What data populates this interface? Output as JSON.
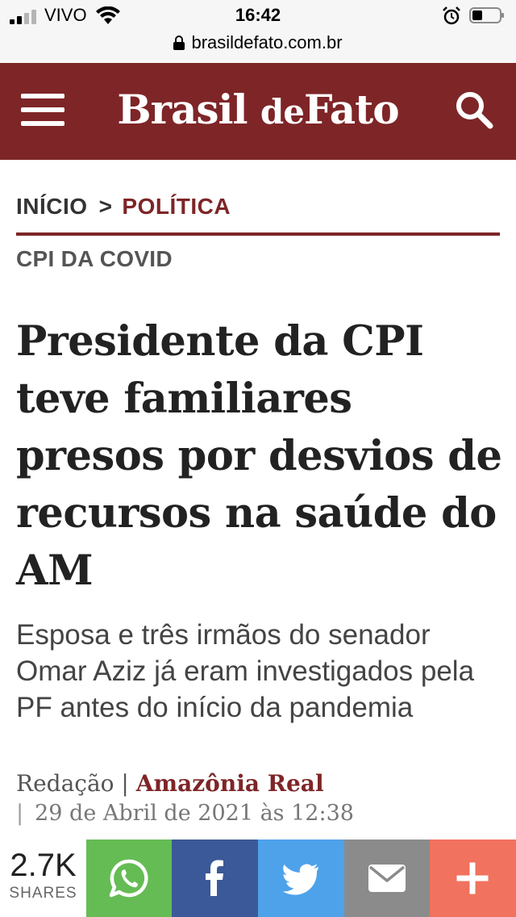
{
  "status_bar": {
    "carrier": "VIVO",
    "time": "16:42",
    "url": "brasildefato.com.br"
  },
  "header": {
    "logo_part1": "Brasil",
    "logo_part2": "de",
    "logo_part3": "Fato",
    "background_color": "#7e2527"
  },
  "breadcrumb": {
    "home": "INÍCIO",
    "separator": ">",
    "category": "POLÍTICA"
  },
  "article": {
    "tag": "CPI DA COVID",
    "headline": "Presidente da CPI teve familiares presos por desvios de recursos na saúde do AM",
    "subheadline": "Esposa e três irmãos do senador Omar Aziz já eram investigados pela PF antes do início da pandemia",
    "author": "Redação",
    "byline_separator": "|",
    "source": "Amazônia Real",
    "date_separator": "|",
    "date": "29 de Abril de 2021 às 12:38"
  },
  "share_bar": {
    "count": "2.7K",
    "count_label": "SHARES",
    "buttons": [
      "whatsapp-icon",
      "facebook-icon",
      "twitter-icon",
      "email-icon",
      "plus-icon"
    ],
    "colors": {
      "whatsapp": "#65bc54",
      "facebook": "#3b5998",
      "twitter": "#4ea2ea",
      "email": "#8b8b8b",
      "more": "#f0725f"
    }
  }
}
